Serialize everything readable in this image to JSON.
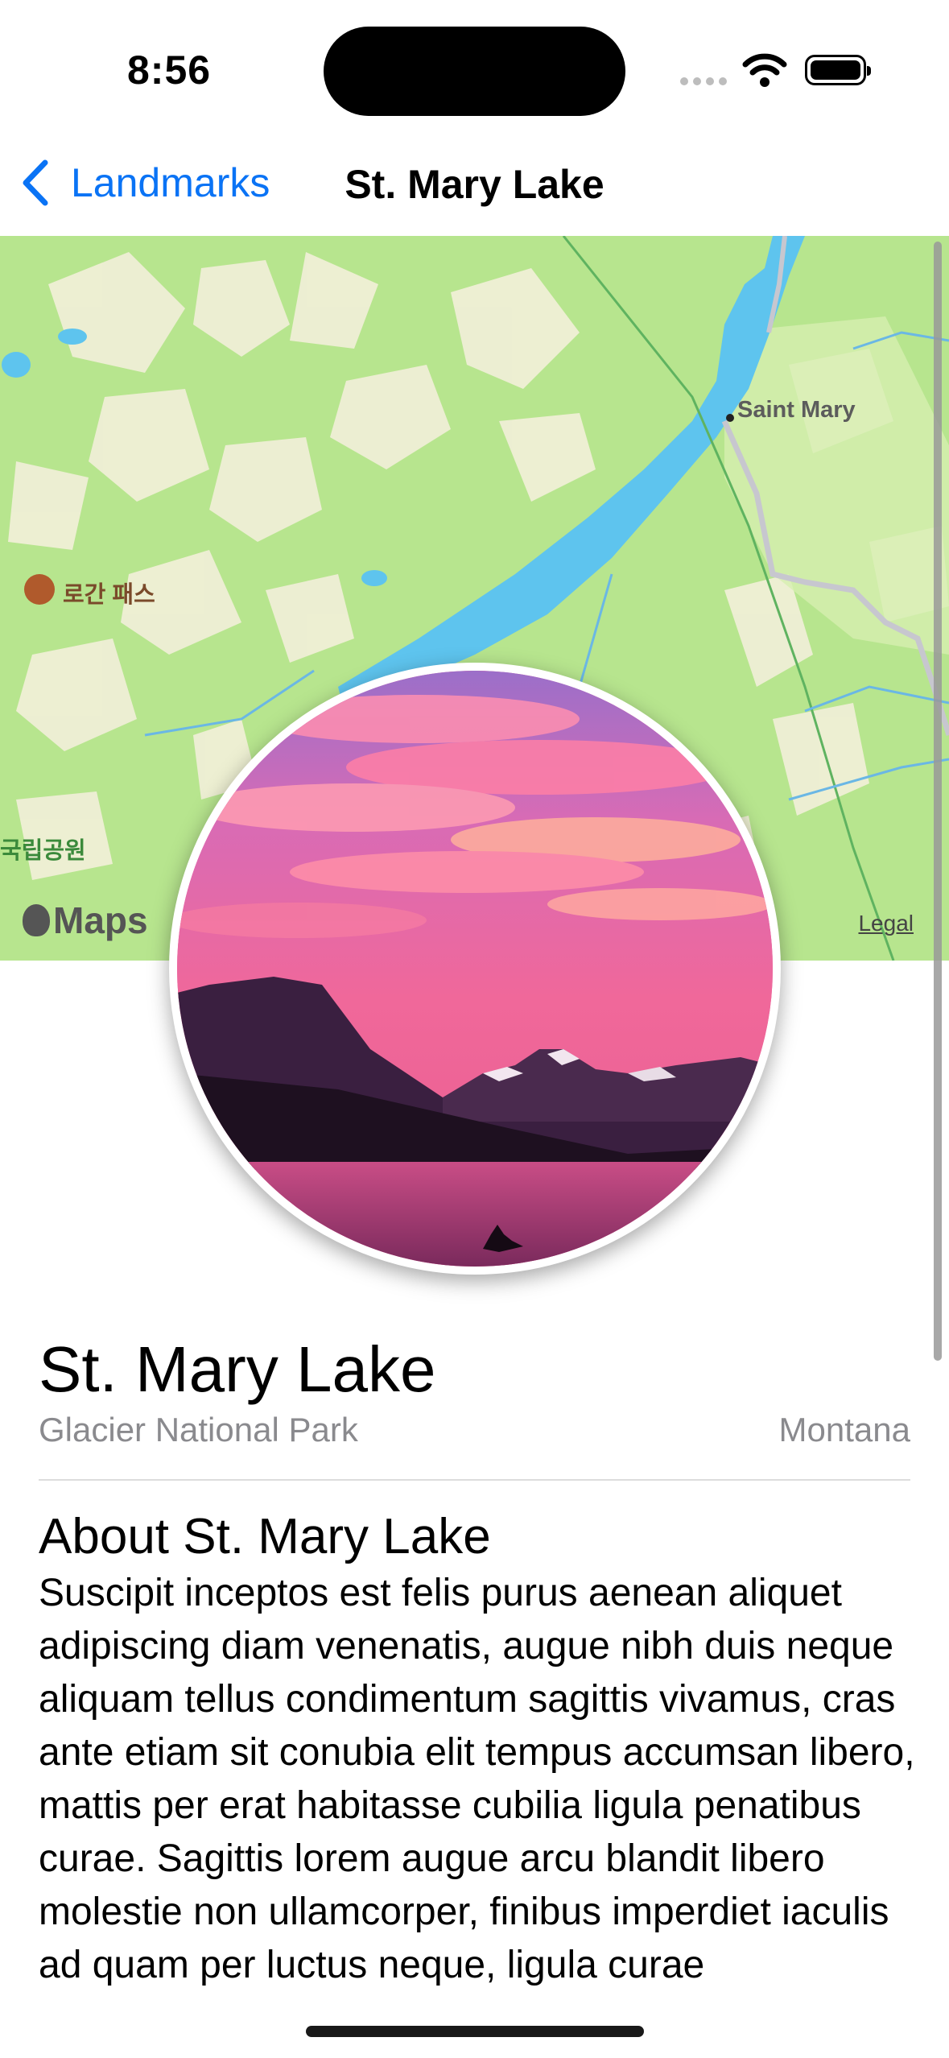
{
  "status_bar": {
    "time": "8:56"
  },
  "nav": {
    "back_label": "Landmarks",
    "title": "St. Mary Lake"
  },
  "map": {
    "place_label": "Saint Mary",
    "poi_label": "로간 패스",
    "park_label": "국립공원",
    "attribution": "Maps",
    "legal_link": "Legal"
  },
  "landmark": {
    "name": "St. Mary Lake",
    "park": "Glacier National Park",
    "state": "Montana",
    "about_title": "About St. Mary Lake",
    "description": "Suscipit inceptos est felis purus aenean aliquet adipiscing diam venenatis, augue nibh duis neque aliquam tellus condimentum sagittis vivamus, cras ante etiam sit conubia elit tempus accumsan libero, mattis per erat habitasse cubilia ligula penatibus curae. Sagittis lorem augue arcu blandit libero molestie non ullamcorper, finibus imperdiet iaculis ad quam per luctus neque, ligula curae"
  },
  "colors": {
    "accent": "#0a73f5",
    "secondary_text": "#8a8a8e",
    "map_green": "#b6e48d",
    "water": "#5ec4ee"
  },
  "icons": {
    "back": "chevron-left-icon",
    "wifi": "wifi-icon",
    "battery": "battery-icon",
    "poi": "mountain-pass-icon"
  }
}
